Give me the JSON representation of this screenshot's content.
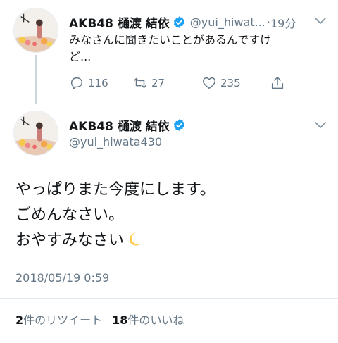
{
  "reply_tweet": {
    "display_name": "AKB48 樋渡 結依",
    "handle": "@yui_hiwat...",
    "separator": "·",
    "time": "19分",
    "text_line1": "みなさんに聞きたいことがあるんですけ",
    "text_line2": "ど...",
    "replies": "116",
    "retweets": "27",
    "likes": "235"
  },
  "main_tweet": {
    "display_name": "AKB48 樋渡 結依",
    "handle": "@yui_hiwata430",
    "text_lines": [
      "やっぱりまた今度にします。",
      "ごめんなさい。",
      "おやすみなさい"
    ],
    "timestamp": "2018/05/19 0:59",
    "retweet_count": "2",
    "retweet_label": "件のリツイート",
    "like_count": "18",
    "like_label": "件のいいね"
  },
  "colors": {
    "verified_blue": "#1da1f2",
    "secondary_text": "#657786",
    "primary_text": "#14171a"
  },
  "icons": {
    "reply": "reply-icon",
    "retweet": "retweet-icon",
    "like": "heart-icon",
    "share": "share-icon",
    "verified": "verified-badge-icon",
    "more": "chevron-down-icon",
    "emoji": "crescent-moon-icon"
  }
}
